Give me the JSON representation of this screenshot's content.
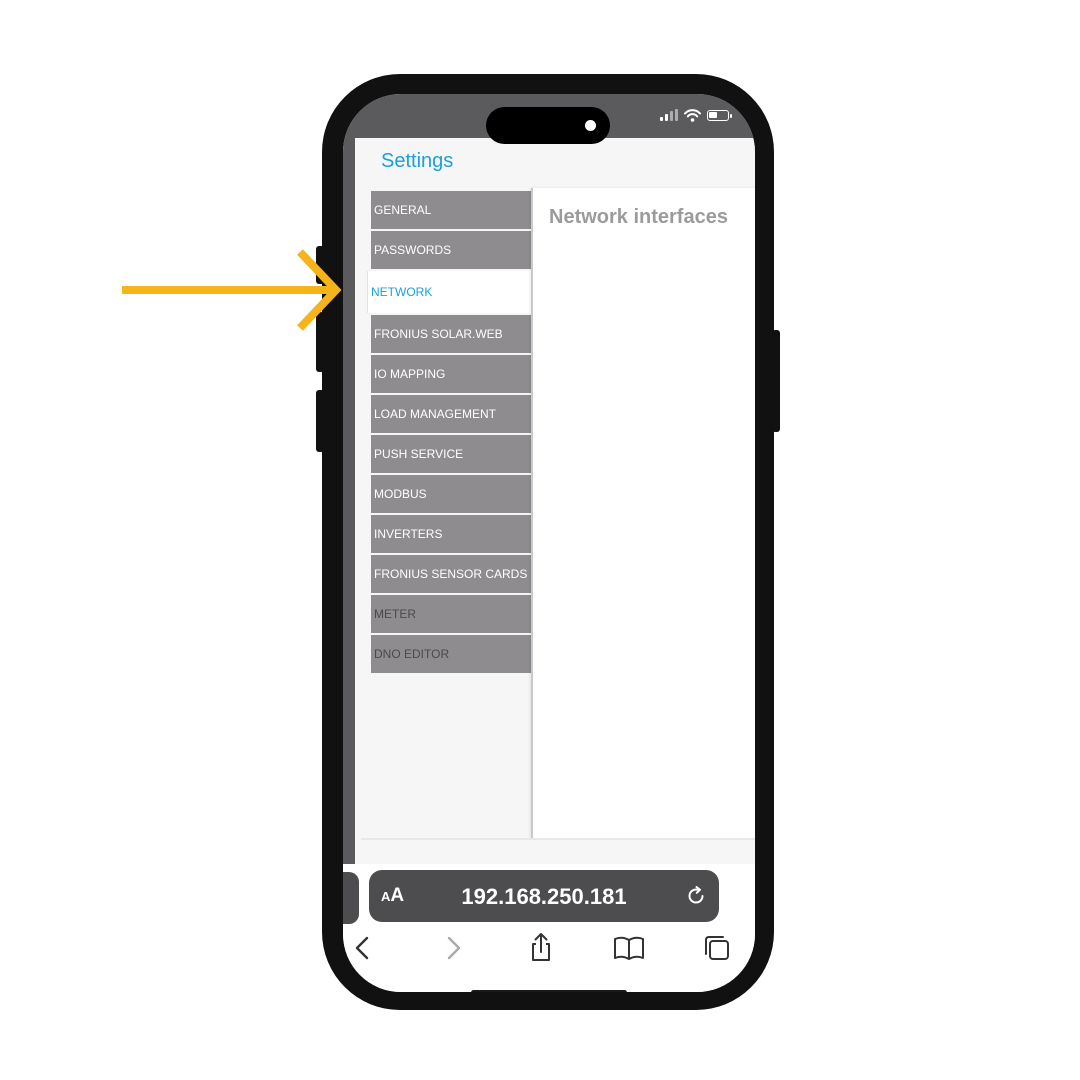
{
  "settings": {
    "title": "Settings"
  },
  "menu": {
    "items": [
      {
        "label": "GENERAL"
      },
      {
        "label": "PASSWORDS"
      },
      {
        "label": "NETWORK"
      },
      {
        "label": "FRONIUS SOLAR.WEB"
      },
      {
        "label": "IO MAPPING"
      },
      {
        "label": "LOAD MANAGEMENT"
      },
      {
        "label": "PUSH SERVICE"
      },
      {
        "label": "MODBUS"
      },
      {
        "label": "INVERTERS"
      },
      {
        "label": "FRONIUS SENSOR CARDS"
      },
      {
        "label": "METER"
      },
      {
        "label": "DNO EDITOR"
      }
    ],
    "active": "NETWORK"
  },
  "content": {
    "heading": "Network interfaces"
  },
  "browser": {
    "aa_label_small": "A",
    "aa_label_large": "A",
    "url": "192.168.250.181"
  },
  "icons": {
    "status": [
      "signal-icon",
      "wifi-icon",
      "battery-icon"
    ],
    "toolbar": [
      "back-icon",
      "forward-icon",
      "share-icon",
      "bookmarks-icon",
      "tabs-icon"
    ],
    "reload": "reload-icon"
  },
  "colors": {
    "accent": "#1ba0dc",
    "menu_bg": "#8e8c8f",
    "arrow": "#f4b41a",
    "status_bar": "#5b5a5c",
    "url_bar": "#4d4c4e"
  }
}
